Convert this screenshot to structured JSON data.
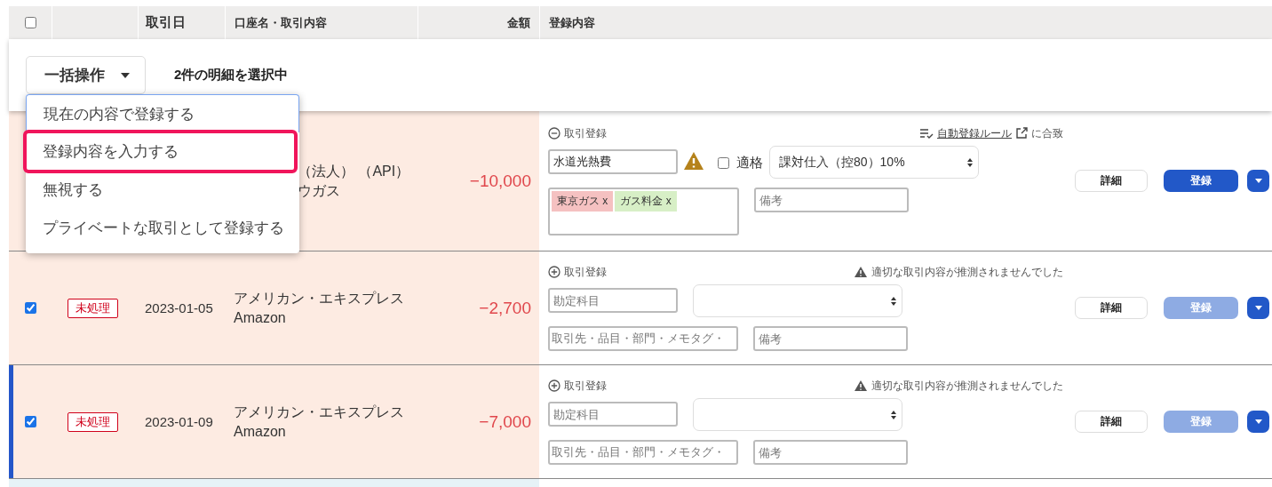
{
  "header": {
    "select_all": {
      "checked": false
    },
    "columns": [
      "",
      "取引日",
      "口座名・取引内容",
      "金額",
      "登録内容"
    ]
  },
  "bulk": {
    "button": "一括操作",
    "count": "2件の明細を選択中",
    "menu": [
      {
        "label": "現在の内容で登録する",
        "highlighted": false
      },
      {
        "label": "登録内容を入力する",
        "highlighted": true
      },
      {
        "label": "無視する",
        "highlighted": false
      },
      {
        "label": "プライベートな取引として登録する",
        "highlighted": false
      }
    ]
  },
  "rows": [
    {
      "covered": true,
      "focused": false,
      "account": [
        "（法人） （API）",
        "ウガス"
      ],
      "amount": "−10,000",
      "entry": {
        "expanded": true,
        "title": "取引登録",
        "rule": {
          "link": "自動登録ルール",
          "suffix": "に合致"
        },
        "account_field": {
          "value": "水道光熱費"
        },
        "warning": true,
        "qualified": {
          "label": "適格",
          "checked": false
        },
        "tax_select": {
          "value": "課対仕入（控80）10%"
        },
        "tags": [
          {
            "label": "東京ガス x",
            "color": "#f5c1c1"
          },
          {
            "label": "ガス料金 x",
            "color": "#d7efc6"
          }
        ],
        "memo_field": {
          "placeholder": "備考"
        },
        "detail_button": "詳細",
        "register_button": "登録",
        "register_enabled": true
      }
    },
    {
      "covered": false,
      "focused": false,
      "selected": true,
      "status": "未処理",
      "date": "2023-01-05",
      "account": [
        "アメリカン・エキスプレス",
        "Amazon"
      ],
      "amount": "−2,700",
      "entry": {
        "expanded": false,
        "title": "取引登録",
        "message": "適切な取引内容が推測されませんでした",
        "account_field": {
          "placeholder": "勘定科目"
        },
        "tags_field": {
          "placeholder": "取引先・品目・部門・メモタグ・"
        },
        "memo_field": {
          "placeholder": "備考"
        },
        "detail_button": "詳細",
        "register_button": "登録",
        "register_enabled": false
      }
    },
    {
      "covered": false,
      "focused": true,
      "selected": true,
      "status": "未処理",
      "date": "2023-01-09",
      "account": [
        "アメリカン・エキスプレス",
        "Amazon"
      ],
      "amount": "−7,000",
      "entry": {
        "expanded": false,
        "title": "取引登録",
        "message": "適切な取引内容が推測されませんでした",
        "account_field": {
          "placeholder": "勘定科目"
        },
        "tags_field": {
          "placeholder": "取引先・品目・部門・メモタグ・"
        },
        "memo_field": {
          "placeholder": "備考"
        },
        "detail_button": "詳細",
        "register_button": "登録",
        "register_enabled": false
      }
    }
  ]
}
